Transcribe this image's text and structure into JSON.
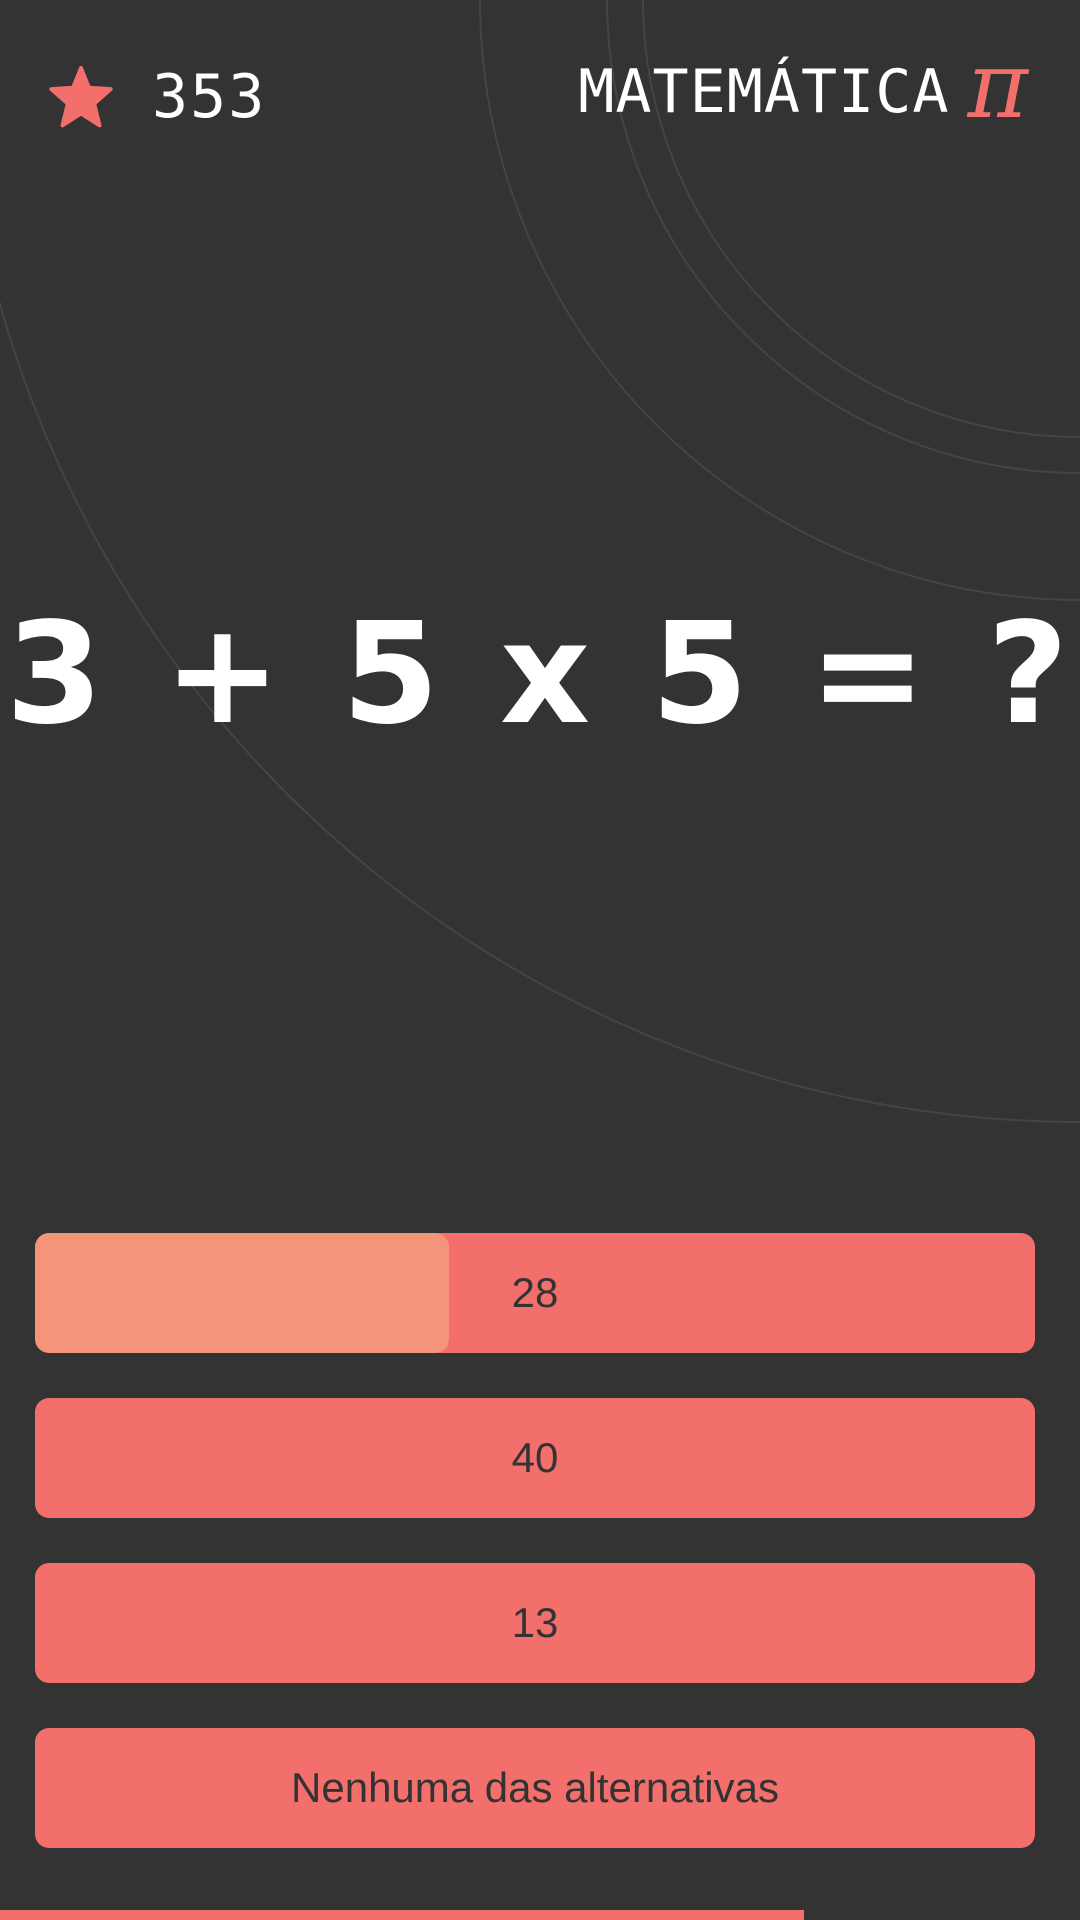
{
  "header": {
    "score": "353",
    "brand_title": "MATEMÁTICA",
    "brand_symbol": "π",
    "star_icon": "star-icon",
    "pi_icon": "pi-icon"
  },
  "question": {
    "text": "3 + 5 x 5 = ?"
  },
  "answers": [
    {
      "label": "28",
      "highlight_fraction": 0.414
    },
    {
      "label": "40"
    },
    {
      "label": "13"
    },
    {
      "label": "Nenhuma das alternativas"
    }
  ],
  "timer": {
    "remaining_fraction": 0.744
  },
  "colors": {
    "background": "#333333",
    "accent": "#f26f6c",
    "highlight": "#f4957a",
    "text_light": "#ffffff",
    "text_dark": "#333333"
  }
}
